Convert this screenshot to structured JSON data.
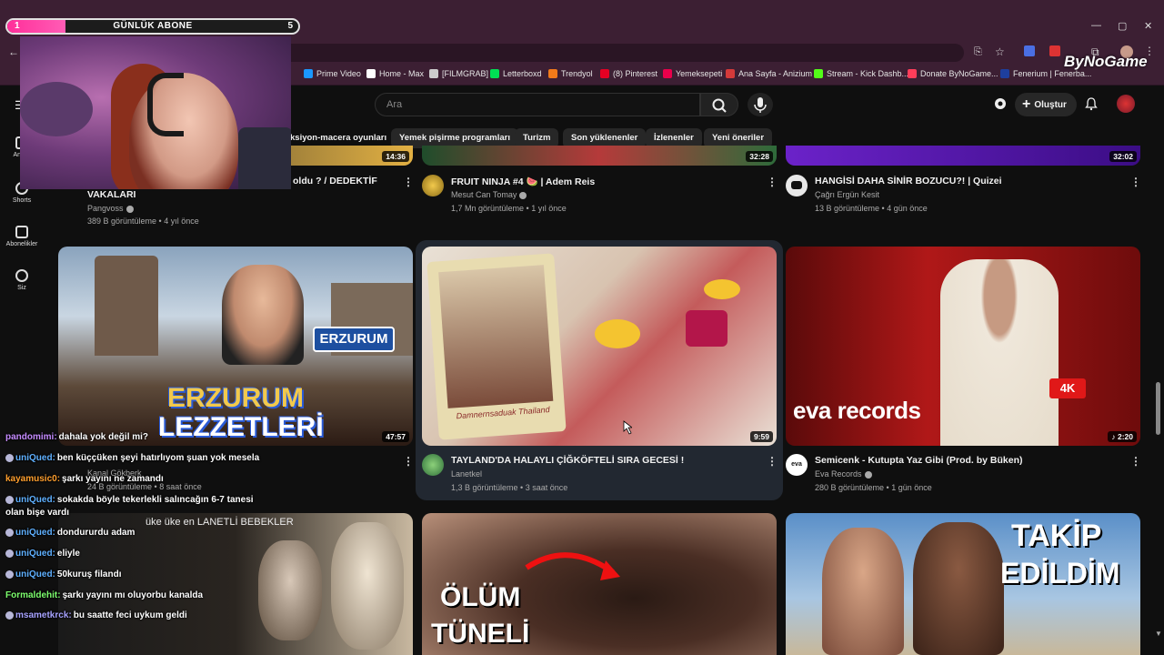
{
  "overlay": {
    "sub_goal_label": "GÜNLÜK ABONE",
    "sub_goal_current": "1",
    "sub_goal_target": "5",
    "sub_goal_progress": 0.2,
    "brand_watermark": "ByNoGame"
  },
  "bookmarks": [
    {
      "label": "Prime Video",
      "color": "#1a98ff"
    },
    {
      "label": "Home - Max",
      "color": "#fff"
    },
    {
      "label": "[FILMGRAB]",
      "color": "#ccc"
    },
    {
      "label": "Letterboxd",
      "color": "#00e054"
    },
    {
      "label": "Trendyol",
      "color": "#f27a1a"
    },
    {
      "label": "(8) Pinterest",
      "color": "#e60023"
    },
    {
      "label": "Yemeksepeti",
      "color": "#ea004b"
    },
    {
      "label": "Ana Sayfa - Anizium",
      "color": "#d43a3a"
    },
    {
      "label": "Stream - Kick Dashb...",
      "color": "#53fc18"
    },
    {
      "label": "Donate ByNoGame...",
      "color": "#ff3d5a"
    },
    {
      "label": "Fenerium | Fenerba...",
      "color": "#1e3f9e"
    }
  ],
  "header": {
    "search_placeholder": "Ara",
    "create_label": "Oluştur"
  },
  "chips": [
    "ksiyon-macera oyunları",
    "Yemek pişirme programları",
    "Turizm",
    "Son yüklenenler",
    "İzlenenler",
    "Yeni öneriler"
  ],
  "sidebar": [
    {
      "label": "Ana S"
    },
    {
      "label": "Shorts"
    },
    {
      "label": "Abonelikler"
    },
    {
      "label": "Siz"
    }
  ],
  "row1": [
    {
      "title_a": "oldu ? / DEDEKTİF",
      "title_b": "VAKALARI",
      "channel": "Pangvoss",
      "meta": "389 B görüntüleme • 4 yıl önce",
      "duration": "14:36"
    },
    {
      "title": "FRUIT NINJA #4 🍉 | Adem Reis",
      "channel": "Mesut Can Tomay",
      "meta": "1,7 Mn görüntüleme • 1 yıl önce",
      "duration": "32:28"
    },
    {
      "title": "HANGİSİ DAHA SİNİR BOZUCU?! | Quizei",
      "channel": "Çağrı Ergün Kesit",
      "meta": "13 B görüntüleme • 4 gün önce",
      "duration": "32:02"
    }
  ],
  "row2": [
    {
      "title": "",
      "channel": "Kanal Gökberk",
      "meta": "24 B görüntüleme • 8 saat önce",
      "duration": "47:57",
      "thumb_text_a": "ERZURUM",
      "thumb_text_b": "LEZZETLERİ",
      "sign": "ERZURUM"
    },
    {
      "title": "TAYLAND'DA HALAYLI ÇİĞKÖFTELİ SIRA GECESİ !",
      "channel": "Lanetkel",
      "meta": "1,3 B görüntüleme • 3 saat önce",
      "duration": "9:59",
      "thumb_text": "Damnernsaduak Thailand"
    },
    {
      "title": "Semicenk - Kutupta Yaz Gibi  (Prod. by Büken)",
      "channel": "Eva Records",
      "meta": "280 B görüntüleme • 1 gün önce",
      "duration": "♪ 2:20",
      "thumb_text": "eva records",
      "badge": "4K",
      "avatar_text": "eva"
    }
  ],
  "row3": [
    {
      "thumb_text": "üke üke en LANETLİ BEBEKLER"
    },
    {
      "thumb_text_a": "ÖLÜM",
      "thumb_text_b": "TÜNELİ"
    },
    {
      "thumb_text_a": "TAKİP",
      "thumb_text_b": "EDİLDİM"
    }
  ],
  "chat": [
    {
      "user": "pandomimi:",
      "color": "#c58bff",
      "text": "dahala yok değil mi?",
      "badge": false
    },
    {
      "user": "uniQued:",
      "color": "#5fb0ff",
      "text": "ben küççüken şeyi hatırlıyom şuan yok mesela",
      "badge": true
    },
    {
      "user": "kayamusic0:",
      "color": "#ff9f2e",
      "text": "şarkı yayını ne zamandı",
      "badge": false
    },
    {
      "user": "uniQued:",
      "color": "#5fb0ff",
      "text": "sokakda böyle tekerlekli salıncağın 6-7 tanesi",
      "text2": "olan bişe vardı",
      "badge": true
    },
    {
      "user": "uniQued:",
      "color": "#5fb0ff",
      "text": "dondururdu adam",
      "badge": true
    },
    {
      "user": "uniQued:",
      "color": "#5fb0ff",
      "text": "eliyle",
      "badge": true
    },
    {
      "user": "uniQued:",
      "color": "#5fb0ff",
      "text": "50kuruş filandı",
      "badge": true
    },
    {
      "user": "Formaldehit:",
      "color": "#7dff6e",
      "text": "şarkı yayını mı oluyorbu kanalda",
      "badge": false
    },
    {
      "user": "msametkrck:",
      "color": "#a7a3ff",
      "text": "bu saatte feci uykum geldi",
      "badge": true
    }
  ]
}
